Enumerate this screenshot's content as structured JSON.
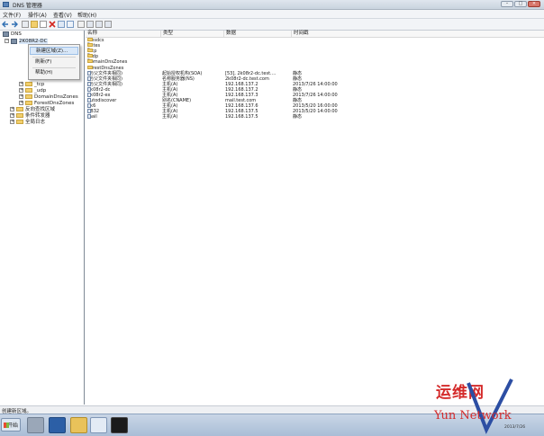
{
  "window": {
    "title": "DNS 管理器"
  },
  "menu": [
    "文件(F)",
    "操作(A)",
    "查看(V)",
    "帮助(H)"
  ],
  "tree": {
    "root": "DNS",
    "server": "2K08R2-DC",
    "items": [
      "_tcp",
      "_udp",
      "DomainDnsZones",
      "ForestDnsZones",
      "反向查找区域",
      "条件转发器",
      "全局日志"
    ]
  },
  "context_menu": {
    "items": [
      "新建区域(Z)...",
      "刷新(F)",
      "帮助(H)"
    ],
    "selected": 0
  },
  "list": {
    "columns": [
      "名称",
      "类型",
      "数据",
      "时间戳"
    ],
    "rows": [
      {
        "name": "_msdcs",
        "type": "",
        "data": "",
        "timestamp": "",
        "kind": "folder"
      },
      {
        "name": "_sites",
        "type": "",
        "data": "",
        "timestamp": "",
        "kind": "folder"
      },
      {
        "name": "_tcp",
        "type": "",
        "data": "",
        "timestamp": "",
        "kind": "folder"
      },
      {
        "name": "_udp",
        "type": "",
        "data": "",
        "timestamp": "",
        "kind": "folder"
      },
      {
        "name": "DomainDnsZones",
        "type": "",
        "data": "",
        "timestamp": "",
        "kind": "folder"
      },
      {
        "name": "ForestDnsZones",
        "type": "",
        "data": "",
        "timestamp": "",
        "kind": "folder"
      },
      {
        "name": "(与父文件夹相同)",
        "type": "起始授权机构(SOA)",
        "data": "[53], 2k08r2-dc.test....",
        "timestamp": "静态",
        "kind": "record"
      },
      {
        "name": "(与父文件夹相同)",
        "type": "名称服务器(NS)",
        "data": "2k08r2-dc.test.com",
        "timestamp": "静态",
        "kind": "record"
      },
      {
        "name": "(与父文件夹相同)",
        "type": "主机(A)",
        "data": "192.168.137.2",
        "timestamp": "2013/7/26 14:00:00",
        "kind": "record"
      },
      {
        "name": "2k08r2-dc",
        "type": "主机(A)",
        "data": "192.168.137.2",
        "timestamp": "静态",
        "kind": "record"
      },
      {
        "name": "2k08r2-ex",
        "type": "主机(A)",
        "data": "192.168.137.3",
        "timestamp": "2013/7/26 14:00:00",
        "kind": "record"
      },
      {
        "name": "autodiscover",
        "type": "别名(CNAME)",
        "data": "mail.test.com",
        "timestamp": "静态",
        "kind": "record"
      },
      {
        "name": "hk6",
        "type": "主机(A)",
        "data": "192.168.137.6",
        "timestamp": "2013/5/20 16:00:00",
        "kind": "record"
      },
      {
        "name": "KB32",
        "type": "主机(A)",
        "data": "192.168.137.5",
        "timestamp": "2013/5/20 14:00:00",
        "kind": "record"
      },
      {
        "name": "mail",
        "type": "主机(A)",
        "data": "192.168.137.5",
        "timestamp": "静态",
        "kind": "record"
      }
    ]
  },
  "status": "创建新区域。",
  "taskbar": {
    "start": "开始",
    "clock": "2013/7/26"
  },
  "watermark": {
    "cn": "运维网",
    "en": "Yun Network"
  },
  "colors": {
    "accent": "#3a78c2",
    "watermark": "#d42a2a",
    "folder": "#f2cf6c"
  }
}
